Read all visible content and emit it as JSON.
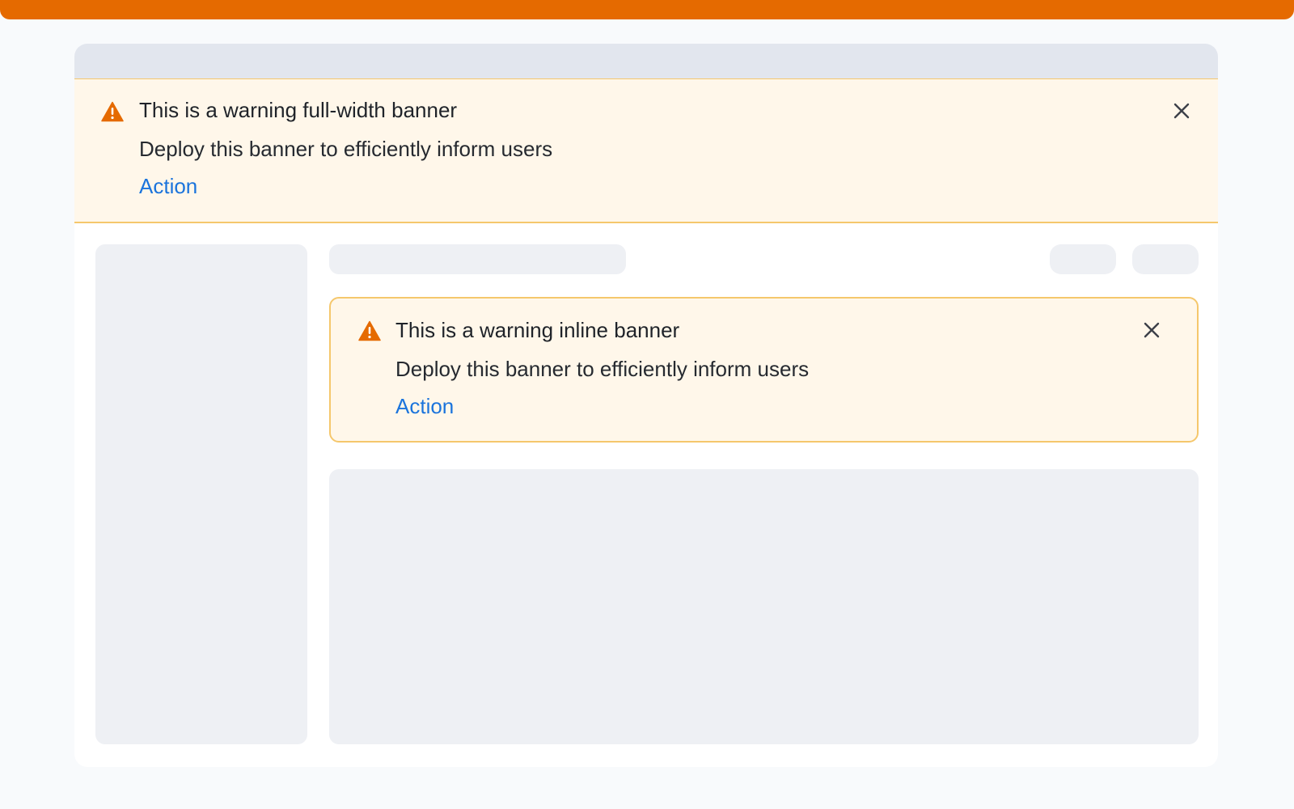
{
  "colors": {
    "accent": "#e56a00",
    "warning_icon": "#e56a00",
    "warning_bg": "#fff7ea",
    "warning_border": "#f5c76c",
    "action_link": "#1b74dc",
    "skeleton": "#eef0f4"
  },
  "full_banner": {
    "icon": "warning-triangle-icon",
    "title": "This is a warning full-width banner",
    "message": "Deploy this banner to efficiently inform users",
    "action_label": "Action",
    "close_icon": "close-icon"
  },
  "inline_banner": {
    "icon": "warning-triangle-icon",
    "title": "This is a warning inline banner",
    "message": "Deploy this banner to efficiently inform users",
    "action_label": "Action",
    "close_icon": "close-icon"
  }
}
